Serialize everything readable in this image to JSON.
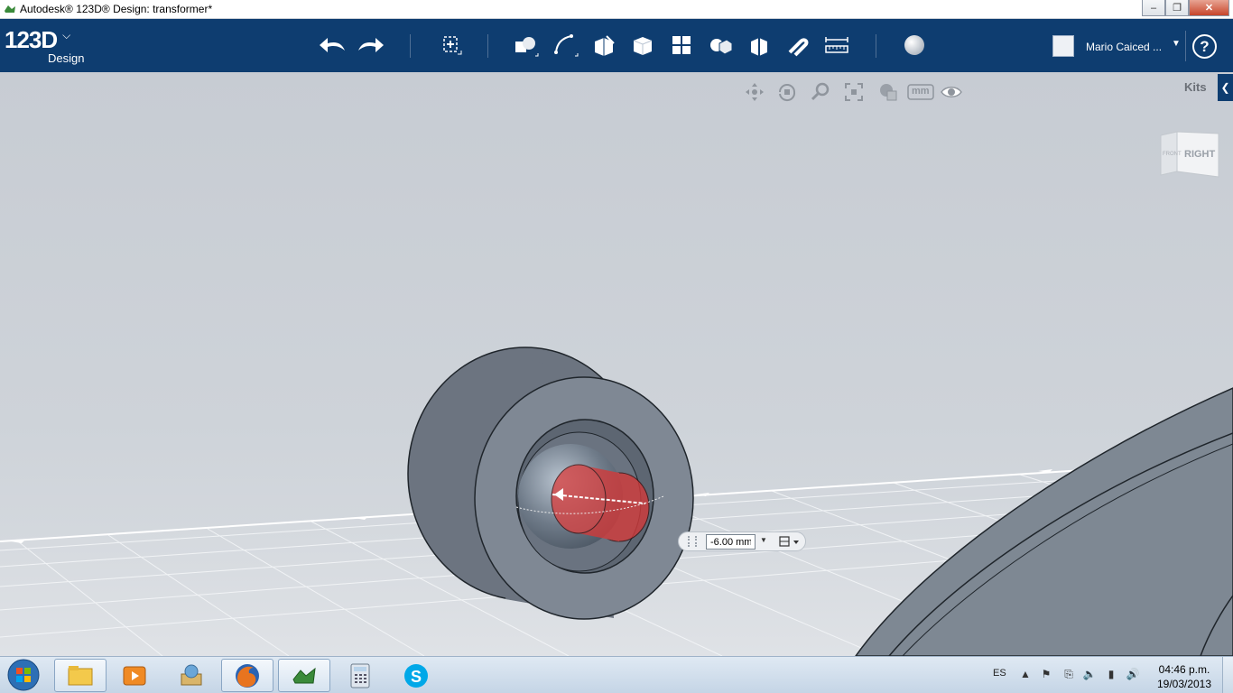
{
  "window": {
    "title": "Autodesk® 123D® Design: transformer*",
    "controls": {
      "minimize": "‒",
      "maximize": "❐",
      "close": "✕"
    }
  },
  "toolbar": {
    "logo_main": "123D",
    "logo_sub": "Design",
    "tools": [
      "undo-icon",
      "redo-icon",
      "transform-icon",
      "primitives-icon",
      "sketch-icon",
      "construct-icon",
      "modify-icon",
      "pattern-icon",
      "grouping-icon",
      "combine-icon",
      "snap-icon",
      "measure-icon",
      "material-icon"
    ],
    "user_name": "Mario Caiced ...",
    "help_label": "?"
  },
  "viewport": {
    "nav_tools": [
      "pan-icon",
      "orbit-icon",
      "zoom-icon",
      "fit-icon",
      "view-mode-icon",
      "units-icon",
      "visibility-icon"
    ],
    "units_label": "mm",
    "kits_label": "Kits",
    "viewcube_face": "RIGHT",
    "viewcube_side": "FRONT",
    "dimension_value": "-6.00 mm",
    "colors": {
      "body": "#7f8894",
      "selected_face": "#d23a3a",
      "grid": "#ffffff"
    }
  },
  "taskbar": {
    "apps": [
      "file-explorer-icon",
      "media-player-icon",
      "archive-icon",
      "firefox-icon",
      "123d-design-icon",
      "calculator-icon",
      "skype-icon"
    ],
    "language": "ES",
    "time": "04:46 p.m.",
    "date": "19/03/2013"
  }
}
